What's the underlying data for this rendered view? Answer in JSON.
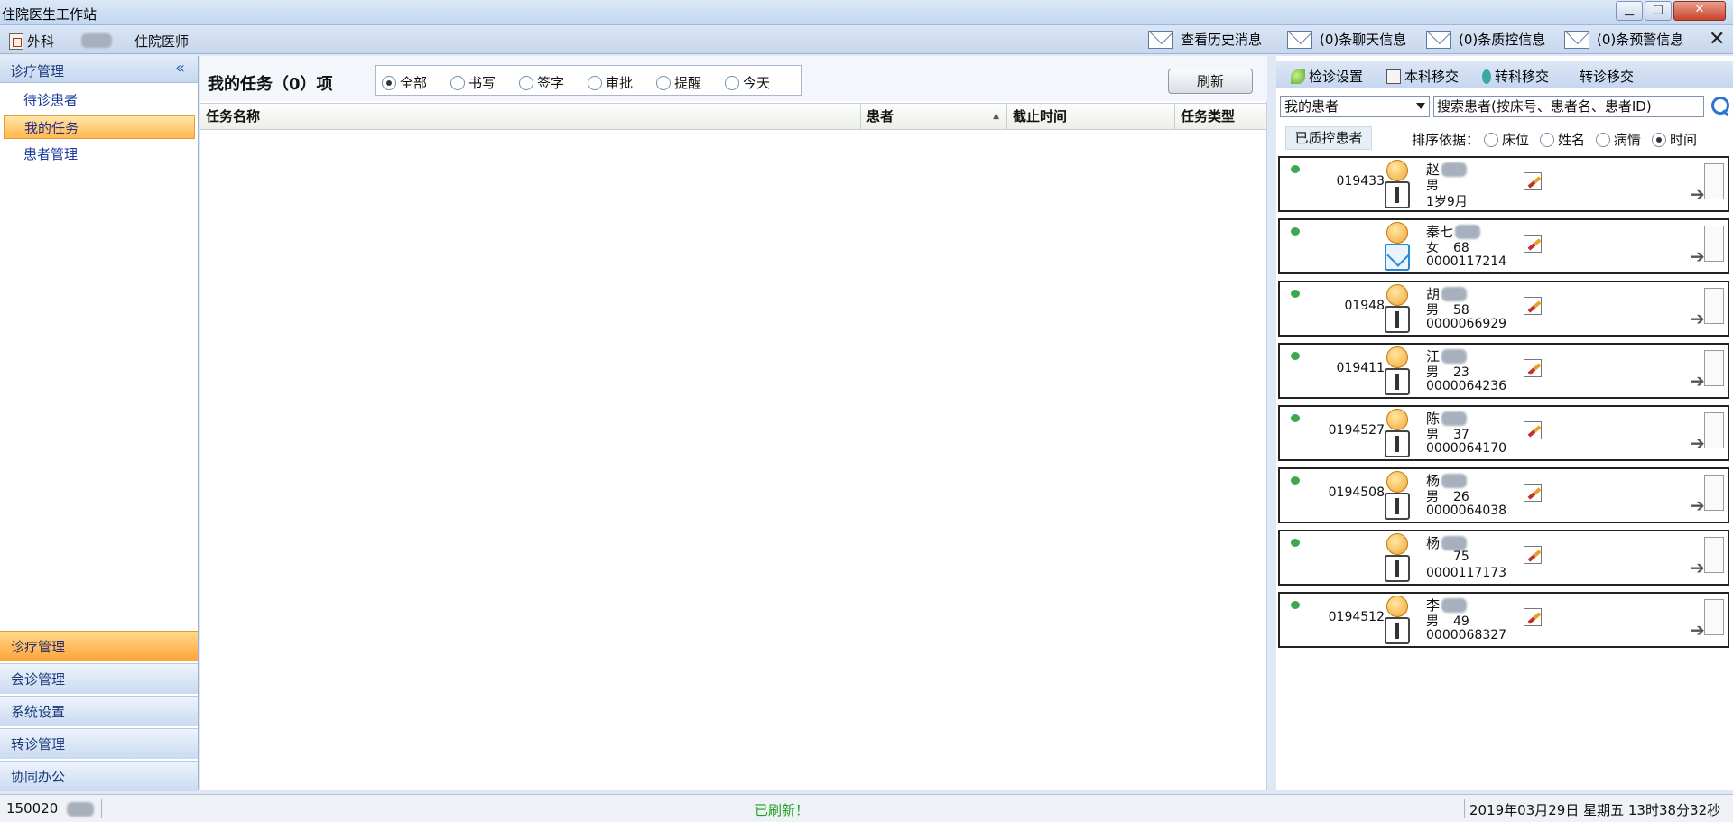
{
  "window": {
    "title": "住院医生工作站",
    "min_glyph": "▁",
    "max_glyph": "▢",
    "close_glyph": "✕"
  },
  "topbar": {
    "department": "外科",
    "role": "住院医师",
    "messages": {
      "history": "查看历史消息",
      "chat": "(0)条聊天信息",
      "qc": "(0)条质控信息",
      "warning": "(0)条预警信息"
    },
    "close_glyph": "✕"
  },
  "sidebar": {
    "section_title": "诊疗管理",
    "collapse_glyph": "«",
    "items": [
      {
        "label": "待诊患者"
      },
      {
        "label": "我的任务"
      },
      {
        "label": "患者管理"
      }
    ],
    "active_item": "我的任务",
    "bottom_nav": [
      {
        "label": "诊疗管理"
      },
      {
        "label": "会诊管理"
      },
      {
        "label": "系统设置"
      },
      {
        "label": "转诊管理"
      },
      {
        "label": "协同办公"
      }
    ],
    "active_bottom": "诊疗管理"
  },
  "tasks": {
    "title": "我的任务（0）项",
    "filters": [
      {
        "label": "全部"
      },
      {
        "label": "书写"
      },
      {
        "label": "签字"
      },
      {
        "label": "审批"
      },
      {
        "label": "提醒"
      },
      {
        "label": "今天"
      }
    ],
    "selected_filter": "全部",
    "refresh_label": "刷新",
    "columns": [
      {
        "label": "任务名称"
      },
      {
        "label": "患者"
      },
      {
        "label": "截止时间"
      },
      {
        "label": "任务类型"
      }
    ],
    "sort_glyph": "▲",
    "rows": []
  },
  "patient_panel": {
    "toolbar": [
      {
        "label": "检诊设置",
        "icon": "leaf-icon"
      },
      {
        "label": "本科移交",
        "icon": "document-icon"
      },
      {
        "label": "转科移交",
        "icon": "runner-icon"
      },
      {
        "label": "转诊移交",
        "icon": ""
      }
    ],
    "scope_select": "我的患者",
    "search_placeholder": "搜索患者(按床号、患者名、患者ID)",
    "qc_label": "已质控患者",
    "sort_label": "排序依据：",
    "sort_options": [
      {
        "label": "床位"
      },
      {
        "label": "姓名"
      },
      {
        "label": "病情"
      },
      {
        "label": "时间"
      }
    ],
    "selected_sort": "时间",
    "status_color": "#3ea851",
    "patients": [
      {
        "bed": "019433",
        "name": "赵",
        "sex": "男",
        "age": "1岁9月",
        "id": "",
        "gender_icon": "male"
      },
      {
        "bed": "",
        "name": "秦七",
        "sex": "女",
        "age": "68",
        "id": "0000117214",
        "gender_icon": "female"
      },
      {
        "bed": "01948",
        "name": "胡",
        "sex": "男",
        "age": "58",
        "id": "0000066929",
        "gender_icon": "male"
      },
      {
        "bed": "019411",
        "name": "江",
        "sex": "男",
        "age": "23",
        "id": "0000064236",
        "gender_icon": "male"
      },
      {
        "bed": "0194527",
        "name": "陈",
        "sex": "男",
        "age": "37",
        "id": "0000064170",
        "gender_icon": "male"
      },
      {
        "bed": "0194508",
        "name": "杨",
        "sex": "男",
        "age": "26",
        "id": "0000064038",
        "gender_icon": "male"
      },
      {
        "bed": "",
        "name": "杨",
        "sex": "",
        "age": "75",
        "id": "0000117173",
        "gender_icon": "male"
      },
      {
        "bed": "0194512",
        "name": "李",
        "sex": "男",
        "age": "49",
        "id": "0000068327",
        "gender_icon": "male"
      }
    ]
  },
  "statusbar": {
    "code": "150020",
    "message": "已刷新！",
    "datetime": "2019年03月29日 星期五 13时38分32秒"
  }
}
